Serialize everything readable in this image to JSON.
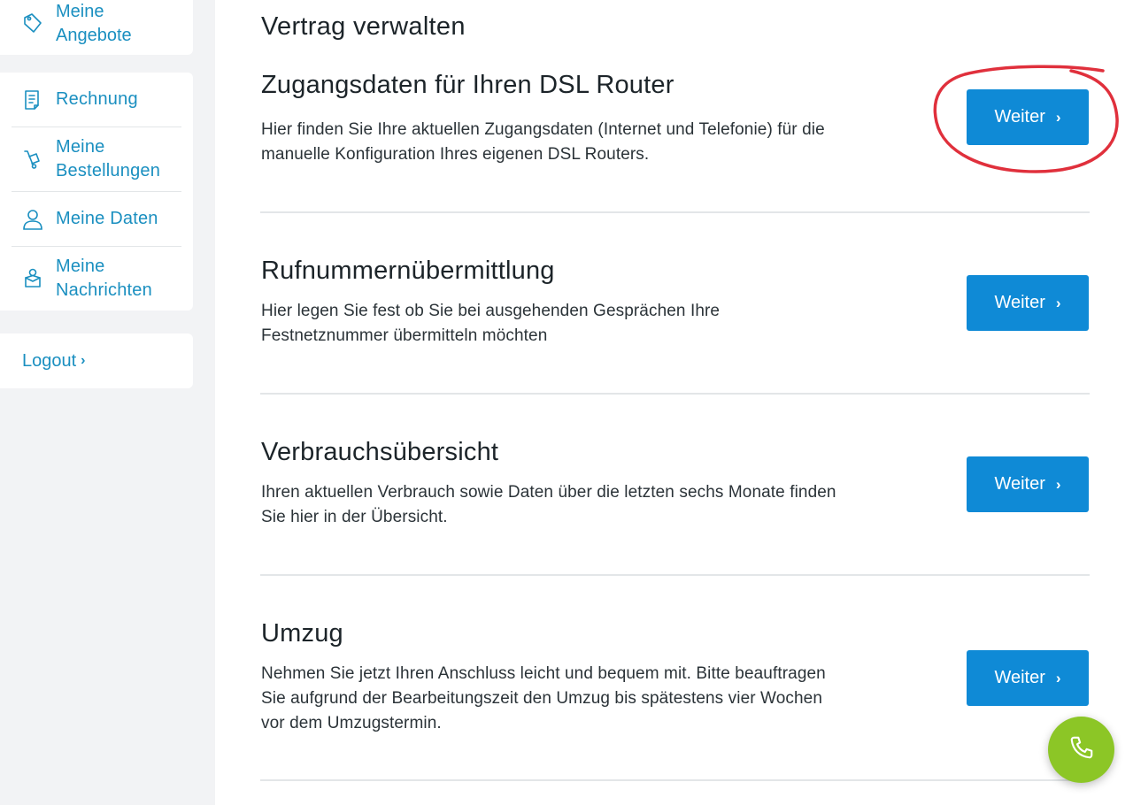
{
  "sidebar": {
    "top_item": {
      "label": "Meine Angebote",
      "icon": "tag-icon"
    },
    "items": [
      {
        "label": "Rechnung",
        "icon": "invoice-icon"
      },
      {
        "label": "Meine Bestellungen",
        "icon": "hand-truck-icon"
      },
      {
        "label": "Meine Daten",
        "icon": "user-icon"
      },
      {
        "label": "Meine Nachrichten",
        "icon": "messages-icon"
      }
    ],
    "logout": {
      "label": "Logout",
      "chevron": "›"
    }
  },
  "main": {
    "title": "Vertrag verwalten",
    "sections": [
      {
        "heading": "Zugangsdaten für Ihren DSL Router",
        "description": "Hier finden Sie Ihre aktuellen Zugangsdaten (Internet und Telefonie) für die manuelle Konfiguration Ihres eigenen DSL Routers.",
        "button": "Weiter"
      },
      {
        "heading": "Rufnummernübermittlung",
        "description": "Hier legen Sie fest ob Sie bei ausgehenden Gesprächen Ihre Festnetznummer übermitteln möchten",
        "button": "Weiter"
      },
      {
        "heading": "Verbrauchsübersicht",
        "description": "Ihren aktuellen Verbrauch sowie Daten über die letzten sechs Monate finden Sie hier in der Übersicht.",
        "button": "Weiter"
      },
      {
        "heading": "Umzug",
        "description": "Nehmen Sie jetzt Ihren Anschluss leicht und bequem mit. Bitte beauftragen Sie aufgrund der Bearbeitungszeit den Umzug bis spätestens vier Wochen vor dem Umzugstermin.",
        "button": "Weiter"
      }
    ]
  },
  "colors": {
    "accent": "#1a8fc0",
    "button": "#0f8ad6",
    "call_button": "#8cc626",
    "annotation": "#e0303c"
  },
  "fab": {
    "icon": "phone-icon"
  }
}
